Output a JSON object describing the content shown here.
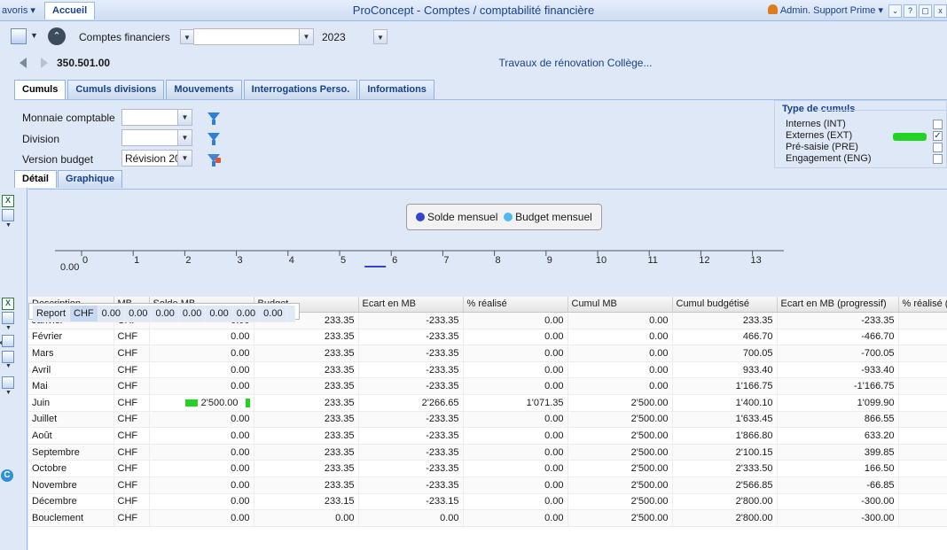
{
  "window": {
    "favoris_label": "avoris",
    "home_tab": "Accueil",
    "title": "ProConcept - Comptes / comptabilité financière",
    "user": "Admin. Support Prime",
    "buttons": [
      "⌄",
      "?",
      "▢",
      "x"
    ]
  },
  "toolbar": {
    "module": "Comptes financiers",
    "second_select": "",
    "year": "2023"
  },
  "account": {
    "number": "350.501.00",
    "description": "Travaux de rénovation Collège..."
  },
  "tabs": [
    "Cumuls",
    "Cumuls divisions",
    "Mouvements",
    "Interrogations Perso.",
    "Informations"
  ],
  "active_tab": "Cumuls",
  "filters": {
    "monnaie_label": "Monnaie comptable",
    "monnaie_value": "",
    "division_label": "Division",
    "division_value": "",
    "version_label": "Version budget",
    "version_value": "Révision 20"
  },
  "type_cumuls": {
    "title": "Type de cumuls",
    "items": [
      {
        "label": "Internes (INT)",
        "checked": false
      },
      {
        "label": "Externes (EXT)",
        "checked": true
      },
      {
        "label": "Pré-saisie (PRE)",
        "checked": false
      },
      {
        "label": "Engagement (ENG)",
        "checked": false
      }
    ]
  },
  "subtabs": [
    "Détail",
    "Graphique"
  ],
  "active_subtab": "Détail",
  "chart_data": {
    "type": "line",
    "series": [
      {
        "name": "Solde mensuel",
        "color": "#3344cc",
        "values": [
          0,
          0,
          0,
          0,
          0,
          2500,
          0,
          0,
          0,
          0,
          0,
          0,
          0
        ]
      },
      {
        "name": "Budget mensuel",
        "color": "#4fb8ee",
        "values": [
          0,
          233.35,
          233.35,
          233.35,
          233.35,
          233.35,
          233.35,
          233.35,
          233.35,
          233.35,
          233.35,
          233.15,
          0
        ]
      }
    ],
    "x": [
      "1",
      "2",
      "3",
      "4",
      "5",
      "6",
      "7",
      "8",
      "9",
      "10",
      "11",
      "12",
      "13"
    ],
    "x_ticks": [
      "0",
      "1",
      "2",
      "3",
      "4",
      "5",
      "6",
      "7",
      "8",
      "9",
      "10",
      "11",
      "12",
      "13"
    ],
    "y_tick": "0.00",
    "legend_position": "top-center"
  },
  "table": {
    "columns": [
      "Description",
      "MB",
      "Solde MB",
      "Budget",
      "Ecart en MB",
      "% réalisé",
      "Cumul MB",
      "Cumul budgétisé",
      "Ecart en MB (progressif)",
      "% réalisé ("
    ],
    "rows": [
      [
        "Report",
        "CHF",
        "0.00",
        "0.00",
        "0.00",
        "0.00",
        "0.00",
        "0.00",
        "0.00",
        ""
      ],
      [
        "Janvier",
        "CHF",
        "0.00",
        "233.35",
        "-233.35",
        "0.00",
        "0.00",
        "233.35",
        "-233.35",
        ""
      ],
      [
        "Février",
        "CHF",
        "0.00",
        "233.35",
        "-233.35",
        "0.00",
        "0.00",
        "466.70",
        "-466.70",
        ""
      ],
      [
        "Mars",
        "CHF",
        "0.00",
        "233.35",
        "-233.35",
        "0.00",
        "0.00",
        "700.05",
        "-700.05",
        ""
      ],
      [
        "Avril",
        "CHF",
        "0.00",
        "233.35",
        "-233.35",
        "0.00",
        "0.00",
        "933.40",
        "-933.40",
        ""
      ],
      [
        "Mai",
        "CHF",
        "0.00",
        "233.35",
        "-233.35",
        "0.00",
        "0.00",
        "1'166.75",
        "-1'166.75",
        ""
      ],
      [
        "Juin",
        "CHF",
        "2'500.00",
        "233.35",
        "2'266.65",
        "1'071.35",
        "2'500.00",
        "1'400.10",
        "1'099.90",
        ""
      ],
      [
        "Juillet",
        "CHF",
        "0.00",
        "233.35",
        "-233.35",
        "0.00",
        "2'500.00",
        "1'633.45",
        "866.55",
        ""
      ],
      [
        "Août",
        "CHF",
        "0.00",
        "233.35",
        "-233.35",
        "0.00",
        "2'500.00",
        "1'866.80",
        "633.20",
        ""
      ],
      [
        "Septembre",
        "CHF",
        "0.00",
        "233.35",
        "-233.35",
        "0.00",
        "2'500.00",
        "2'100.15",
        "399.85",
        ""
      ],
      [
        "Octobre",
        "CHF",
        "0.00",
        "233.35",
        "-233.35",
        "0.00",
        "2'500.00",
        "2'333.50",
        "166.50",
        ""
      ],
      [
        "Novembre",
        "CHF",
        "0.00",
        "233.35",
        "-233.35",
        "0.00",
        "2'500.00",
        "2'566.85",
        "-66.85",
        ""
      ],
      [
        "Décembre",
        "CHF",
        "0.00",
        "233.15",
        "-233.15",
        "0.00",
        "2'500.00",
        "2'800.00",
        "-300.00",
        ""
      ],
      [
        "Bouclement",
        "CHF",
        "0.00",
        "0.00",
        "0.00",
        "0.00",
        "2'500.00",
        "2'800.00",
        "-300.00",
        ""
      ]
    ]
  },
  "colors": {
    "header_text": "#15428b",
    "panel_bg": "#dfe8f6",
    "highlight_mark": "#22d321"
  }
}
